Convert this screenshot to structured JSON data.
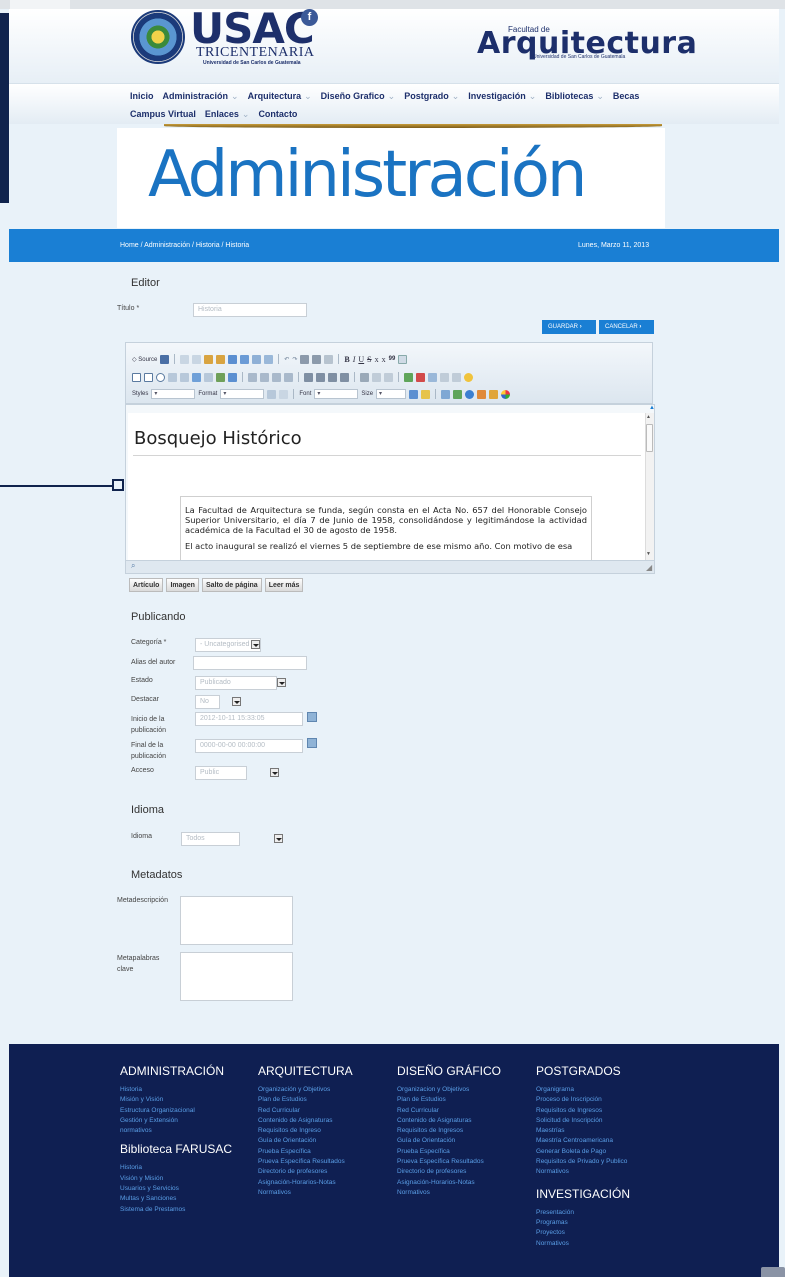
{
  "header": {
    "usac_title": "USAC",
    "usac_tricentenaria": "TRICENTENARIA",
    "usac_subtitle": "Universidad de San Carlos de Guatemala",
    "fb_letter": "f",
    "faculty_small": "Facultad de",
    "faculty_big": "Arquitectura",
    "faculty_sub": "Universidad de San Carlos de Guatemala"
  },
  "nav": {
    "row1": [
      {
        "label": "Inicio",
        "arrow": ""
      },
      {
        "label": "Administración",
        "arrow": "⌄"
      },
      {
        "label": "Arquitectura",
        "arrow": "⌄"
      },
      {
        "label": "Diseño Grafico",
        "arrow": "⌄"
      },
      {
        "label": "Postgrado",
        "arrow": "⌄"
      },
      {
        "label": "Investigación",
        "arrow": "⌄"
      },
      {
        "label": "Bibliotecas",
        "arrow": "⌄"
      },
      {
        "label": "Becas",
        "arrow": ""
      }
    ],
    "row2": [
      {
        "label": "Campus Virtual",
        "arrow": ""
      },
      {
        "label": "Enlaces",
        "arrow": "⌄"
      },
      {
        "label": "Contacto",
        "arrow": ""
      }
    ]
  },
  "banner": {
    "title": "Administración"
  },
  "breadcrumb": "Home / Administración / Historia / Historia",
  "date": "Lunes, Marzo 11, 2013",
  "editor_section": {
    "title": "Editor",
    "titulo_label": "Título *",
    "titulo_placeholder": "Historia",
    "save_label": "GUARDAR",
    "cancel_label": "CANCELAR"
  },
  "toolbar": {
    "source_label": "Source",
    "styles_label": "Styles",
    "format_label": "Format",
    "font_label": "Font",
    "size_label": "Size",
    "bold": "B",
    "italic": "I",
    "underline": "U",
    "strike": "S",
    "sub": "x",
    "sup": "x",
    "quote": "99"
  },
  "document": {
    "heading": "Bosquejo Histórico",
    "p1": "La Facultad de Arquitectura se funda, según consta en el Acta No. 657 del Honorable Consejo Superior Universitario, el día 7 de Junio de 1958, consolidándose y legitimándose la actividad académica de la Facultad el 30 de agosto de 1958.",
    "p2": "El acto inaugural se realizó el viernes 5 de septiembre de ese mismo año. Con motivo de esa"
  },
  "editor_buttons": [
    "Artículo",
    "Imagen",
    "Salto de página",
    "Leer más"
  ],
  "publicando": {
    "title": "Publicando",
    "categoria_label": "Categoría *",
    "categoria_value": "- Uncategorised",
    "alias_label": "Alias del autor",
    "estado_label": "Estado",
    "estado_value": "Publicado",
    "destacar_label": "Destacar",
    "destacar_value": "No",
    "inicio_label_1": "Inicio de la",
    "inicio_label_2": "publicación",
    "inicio_value": "2012-10-11 15:33:05",
    "final_label_1": "Final de la",
    "final_label_2": "publicación",
    "final_value": "0000-00-00 00:00:00",
    "acceso_label": "Acceso",
    "acceso_value": "Public"
  },
  "idioma": {
    "title": "Idioma",
    "label": "Idioma",
    "value": "Todos"
  },
  "metadatos": {
    "title": "Metadatos",
    "desc_label": "Metadescripción",
    "keys_label_1": "Metapalabras",
    "keys_label_2": "clave"
  },
  "footer": {
    "col1": {
      "title": "ADMINISTRACIÓN",
      "links": [
        "Historia",
        "Misión y Visión",
        "Estructura Organizacional",
        "Gestión y Extensión",
        "normativos"
      ],
      "title2": "Biblioteca FARUSAC",
      "links2": [
        "Historia",
        "Visión y Misión",
        "Usuarios y Servicios",
        "Multas y Sanciones",
        "Sistema de Prestamos"
      ]
    },
    "col2": {
      "title": "ARQUITECTURA",
      "links": [
        "Organización y Objetivos",
        "Plan de Estudios",
        "Red Curricular",
        "Contenido de Asignaturas",
        "Requisitos de Ingreso",
        "Guía de Orientación",
        "Prueba Específica",
        "Prueva Específica Resultados",
        "Directorio de profesores",
        "Asignación-Horarios-Notas",
        "Normativos"
      ]
    },
    "col3": {
      "title": "DISEÑO GRÁFICO",
      "links": [
        "Organizacion y Objetivos",
        "Plan de Estudios",
        "Red Curricular",
        "Contenido de Asignaturas",
        "Requisitos de Ingresos",
        "Guía de Orientación",
        "Prueba Específica",
        "Prueva Específica Resultados",
        "Directorio de profesores",
        "Asignación-Horarios-Notas",
        "Normativos"
      ]
    },
    "col4": {
      "title": "POSTGRADOS",
      "links": [
        "Organigrama",
        "Proceso de Inscripción",
        "Requisitos de Ingresos",
        "Solicitud de Inscripción",
        "Maestrías",
        "Maestría Centroamericana",
        "Generar Boleta de Pago",
        "Requisitos de Privado y Publico",
        "Normativos"
      ],
      "title2": "INVESTIGACIÓN",
      "links2": [
        "Presentación",
        "Programas",
        "Proyectos",
        "Normativos"
      ]
    }
  }
}
